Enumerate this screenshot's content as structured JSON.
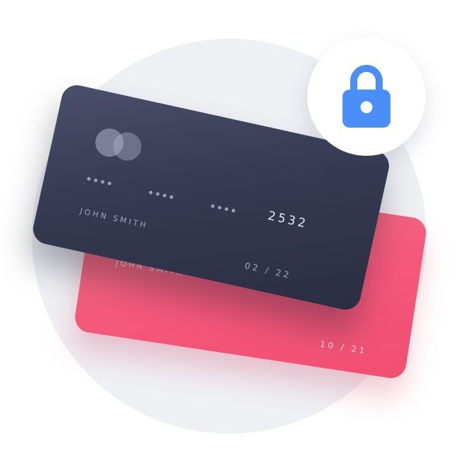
{
  "colors": {
    "background_circle": "#eff0f4",
    "front_card": "#363a52",
    "back_card": "#f4587a",
    "lock_icon": "#4a8ef7",
    "badge": "#ffffff"
  },
  "front_card": {
    "logo_icon": "card-logo-circles-icon",
    "number_groups": [
      "••••",
      "••••",
      "••••"
    ],
    "last_digits": "2532",
    "holder_name": "JOHN SMITH",
    "expiry": "02 / 22"
  },
  "back_card": {
    "holder_name": "JOHN SMITH",
    "expiry": "10 / 21"
  },
  "badge": {
    "icon": "lock-icon"
  }
}
